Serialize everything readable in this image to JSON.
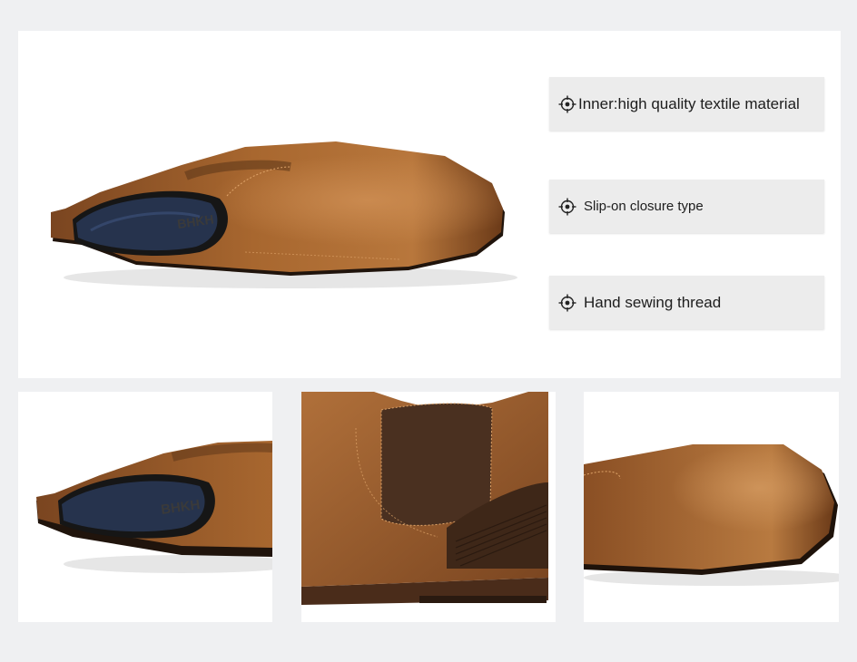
{
  "features": [
    {
      "icon": "crosshair-bullet-icon",
      "text": "Inner:high quality textile material"
    },
    {
      "icon": "crosshair-bullet-icon",
      "text": "Slip-on closure type"
    },
    {
      "icon": "crosshair-bullet-icon",
      "text": "Hand sewing thread"
    }
  ],
  "boot_branding": "BHKH",
  "colors": {
    "page_background": "#eff0f2",
    "panel_background": "#ffffff",
    "feature_background": "#ececec",
    "leather": "#a0622e",
    "leather_dark": "#5a3417",
    "sole": "#3a2416",
    "insole": "#2a3a5a"
  }
}
